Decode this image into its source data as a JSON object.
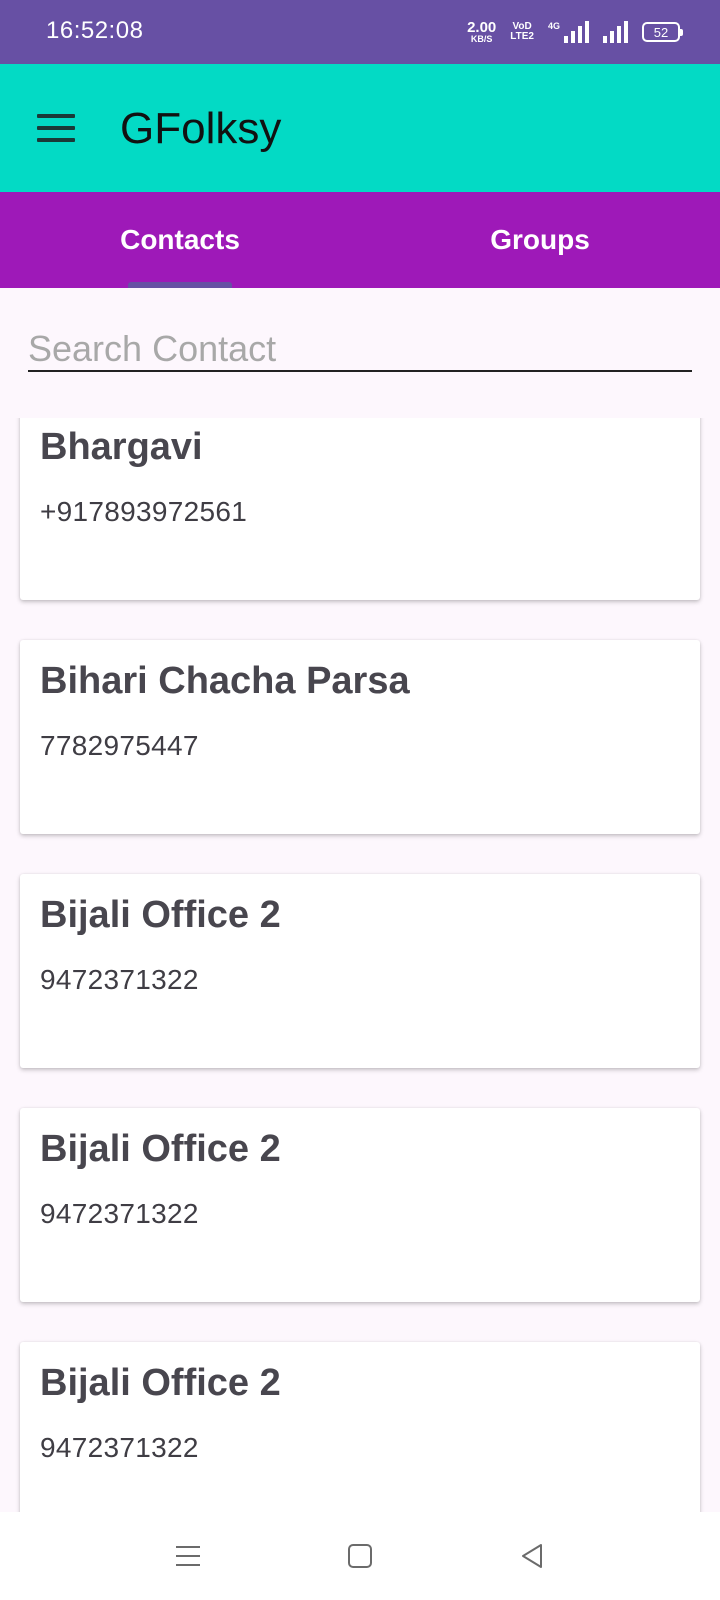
{
  "status_bar": {
    "time": "16:52:08",
    "net_speed_value": "2.00",
    "net_speed_unit": "KB/S",
    "volte_top": "VoD",
    "volte_bottom": "LTE2",
    "network_tag": "4G",
    "battery_level": "52"
  },
  "app_bar": {
    "title": "GFolksy"
  },
  "tabs": [
    {
      "label": "Contacts",
      "selected": true
    },
    {
      "label": "Groups",
      "selected": false
    }
  ],
  "search": {
    "placeholder": "Search Contact",
    "value": ""
  },
  "contacts": [
    {
      "name": "Bhargavi",
      "phone": "+917893972561"
    },
    {
      "name": "Bihari Chacha Parsa",
      "phone": "7782975447"
    },
    {
      "name": "Bijali Office 2",
      "phone": "9472371322"
    },
    {
      "name": "Bijali Office 2",
      "phone": "9472371322"
    },
    {
      "name": "Bijali Office 2",
      "phone": "9472371322"
    }
  ],
  "colors": {
    "status_bar": "#6750a4",
    "app_bar": "#03dac5",
    "tab_bar": "#9e19b8",
    "tab_indicator": "#6750a4",
    "background": "#fdf7fd",
    "card_text": "#48464e"
  },
  "icons": {
    "menu": "hamburger-menu-icon",
    "nav_recents": "menu-lines-icon",
    "nav_home": "square-icon",
    "nav_back": "back-triangle-icon"
  }
}
